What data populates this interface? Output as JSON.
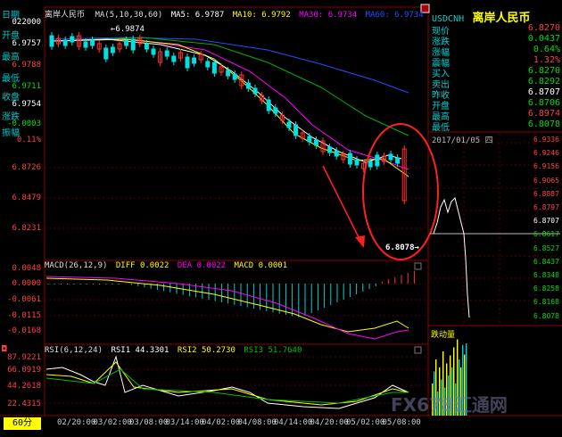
{
  "header": {
    "instrument": "离岸人民币",
    "ma_label": "MA(5,10,30,60)",
    "ma5": "MA5: 6.9787",
    "ma10": "MA10: 6.9792",
    "ma30": "MA30: 6.9734",
    "ma60": "MA60: 6.9734",
    "colors": {
      "ma5": "#ffffff",
      "ma10": "#ffff00",
      "ma30": "#ff00ff",
      "ma60": "#00c000"
    }
  },
  "left_panel": {
    "date_label": "日期",
    "date_value": "022000",
    "open_label": "开盘",
    "open_value": "6.9757",
    "high_label": "最高",
    "high_value": "6.9788",
    "low_label": "最低",
    "low_value": "6.9711",
    "close_label": "收盘",
    "close_value": "6.9754",
    "change_label": "涨跌",
    "change_value": "-0.0003",
    "amp_label": "振幅",
    "amp_value": "0.11%"
  },
  "price_axis": [
    "6.8726",
    "6.8479",
    "6.8231"
  ],
  "annotations": {
    "top_high": "6.9874",
    "low_marker": "6.8078"
  },
  "macd": {
    "label": "MACD(26,12,9)",
    "diff": "DIFF 0.0022",
    "dea": "DEA 0.0022",
    "macd": "MACD 0.0001",
    "axis": [
      "0.0048",
      "0.0000",
      "-0.0061",
      "-0.0115",
      "-0.0168"
    ]
  },
  "rsi": {
    "label": "RSI(6,12,24)",
    "rsi1": "RSI1 44.3301",
    "rsi2": "RSI2 50.2730",
    "rsi3": "RSI3 51.7640",
    "axis": [
      "87.9221",
      "66.0919",
      "44.2618",
      "22.4315"
    ]
  },
  "period_button": "60分",
  "time_axis": [
    "02/20:00",
    "03/02:00",
    "03/08:00",
    "03/14:00",
    "04/02:00",
    "04/08:00",
    "04/14:00",
    "04/20:00",
    "05/02:00",
    "05/08:00"
  ],
  "quote": {
    "code": "USDCNH",
    "name": "离岸人民币",
    "rows": [
      {
        "k": "现价",
        "v": "6.8270",
        "c": "#ff4040"
      },
      {
        "k": "涨跌",
        "v": "0.0437",
        "c": "#00e000"
      },
      {
        "k": "涨幅",
        "v": "0.64%",
        "c": "#00e000"
      },
      {
        "k": "震幅",
        "v": "1.32%",
        "c": "#ff4040"
      },
      {
        "k": "买入",
        "v": "6.8270",
        "c": "#00e000"
      },
      {
        "k": "卖出",
        "v": "6.8292",
        "c": "#00e000"
      },
      {
        "k": "昨收",
        "v": "6.8707",
        "c": "#ffffff"
      },
      {
        "k": "开盘",
        "v": "6.8706",
        "c": "#00e000"
      },
      {
        "k": "最高",
        "v": "6.8974",
        "c": "#ff4040"
      },
      {
        "k": "最低",
        "v": "6.8078",
        "c": "#00e000"
      }
    ]
  },
  "intraday": {
    "date": "2017/01/05 四",
    "axis": [
      "6.9336",
      "6.9246",
      "6.9156",
      "6.9065",
      "6.8887",
      "6.8797",
      "6.8707",
      "6.8617",
      "6.8527",
      "6.8437",
      "6.8348",
      "6.8258",
      "6.8168",
      "6.8078"
    ],
    "volume_label": "跌动量"
  },
  "watermark": "FX678汇通网"
}
